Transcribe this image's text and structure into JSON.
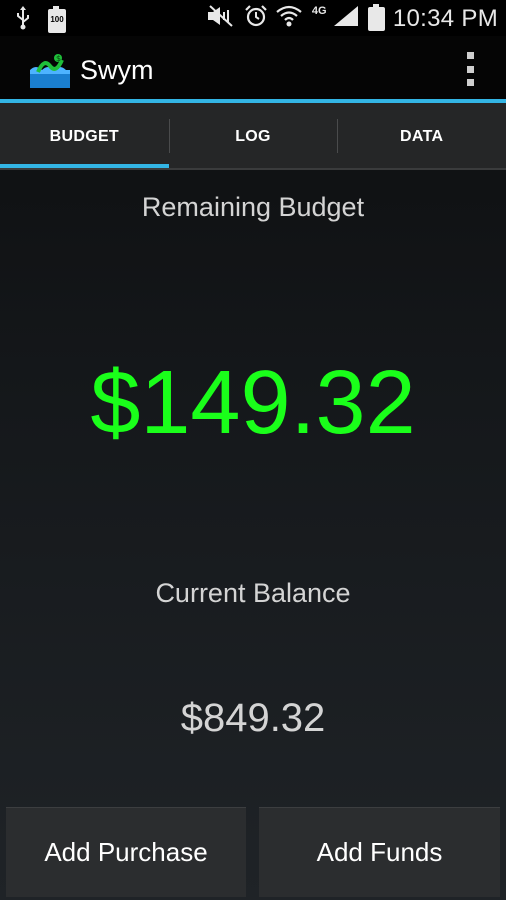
{
  "status_bar": {
    "time": "10:34 PM",
    "battery_level": "100",
    "network": "4G",
    "icons": [
      "usb-icon",
      "battery-icon",
      "mute-icon",
      "alarm-icon",
      "wifi-icon",
      "signal-icon"
    ]
  },
  "app": {
    "title": "Swym",
    "logo_icon": "swym-logo-icon",
    "overflow_icon": "overflow-menu-icon"
  },
  "tabs": [
    {
      "label": "BUDGET",
      "active": true
    },
    {
      "label": "LOG",
      "active": false
    },
    {
      "label": "DATA",
      "active": false
    }
  ],
  "budget": {
    "remaining_label": "Remaining Budget",
    "remaining_value": "$149.32",
    "balance_label": "Current Balance",
    "balance_value": "$849.32"
  },
  "actions": {
    "add_purchase": "Add Purchase",
    "add_funds": "Add Funds"
  },
  "colors": {
    "accent": "#33b5e5",
    "remaining_value": "#1aff1a",
    "text": "#d4d4d4"
  }
}
